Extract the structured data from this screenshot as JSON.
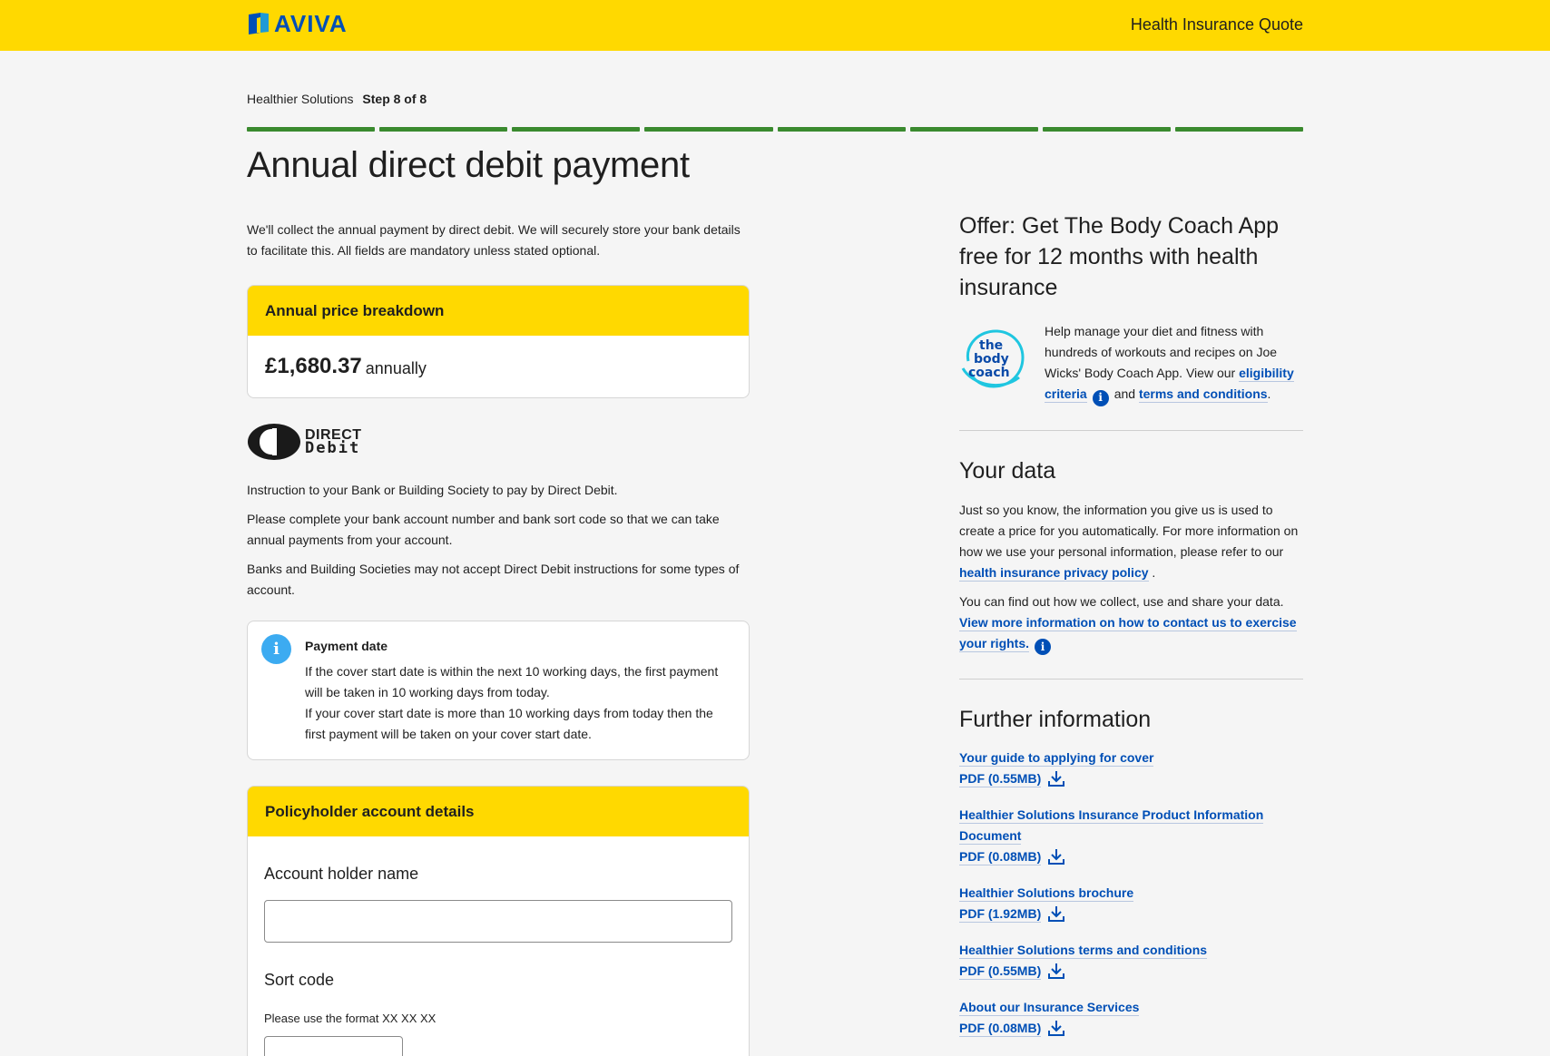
{
  "header": {
    "brand": "AVIVA",
    "title": "Health Insurance Quote"
  },
  "progress": {
    "label": "Healthier Solutions",
    "step": "Step 8 of 8",
    "current": 8,
    "total": 8
  },
  "page": {
    "title": "Annual direct debit payment",
    "intro": "We'll collect the annual payment by direct debit. We will securely store your bank details to facilitate this. All fields are mandatory unless stated optional."
  },
  "price": {
    "heading": "Annual price breakdown",
    "amount": "£1,680.37",
    "unit": "annually"
  },
  "direct_debit": {
    "logo_line1": "DIRECT",
    "logo_line2": "Debit",
    "p1": "Instruction to your Bank or Building Society to pay by Direct Debit.",
    "p2": "Please complete your bank account number and bank sort code so that we can take annual payments from your account.",
    "p3": "Banks and Building Societies may not accept Direct Debit instructions for some types of account."
  },
  "payment_date": {
    "icon": "info-icon",
    "title": "Payment date",
    "line1": "If the cover start date is within the next 10 working days, the first payment will be taken in 10 working days from today.",
    "line2": "If your cover start date is more than 10 working days from today then the first payment will be taken on your cover start date."
  },
  "account": {
    "heading": "Policyholder account details",
    "name_label": "Account holder name",
    "name_value": "",
    "sort_label": "Sort code",
    "sort_hint": "Please use the format XX XX XX",
    "sort_value": ""
  },
  "offer": {
    "title": "Offer: Get The Body Coach App free for 12 months with health insurance",
    "logo_text": [
      "the",
      "body",
      "coach"
    ],
    "text_before": "Help manage your diet and fitness with hundreds of workouts and recipes on Joe Wicks' Body Coach App. View our ",
    "eligibility_link": "eligibility criteria",
    "and_text": "and",
    "terms_link": "terms and conditions",
    "end": "."
  },
  "your_data": {
    "title": "Your data",
    "p1_text": "Just so you know, the information you give us is used to create a price for you automatically.  For more information on how we use your personal information, please refer to our ",
    "p1_link": "health insurance privacy policy",
    "p1_end": " .",
    "p2_text": "You can find out how we collect, use and share your data.",
    "p2_link": "View more information on how to contact us to exercise your rights."
  },
  "further": {
    "title": "Further information",
    "docs": [
      {
        "title": "Your guide to applying for cover",
        "file": "PDF (0.55MB)"
      },
      {
        "title": "Healthier Solutions Insurance Product Information Document",
        "file": "PDF (0.08MB)"
      },
      {
        "title": "Healthier Solutions brochure",
        "file": "PDF (1.92MB)"
      },
      {
        "title": "Healthier Solutions terms and conditions",
        "file": "PDF (0.55MB)"
      },
      {
        "title": "About our Insurance Services",
        "file": "PDF (0.08MB)"
      }
    ]
  },
  "colors": {
    "brand_yellow": "#ffd900",
    "brand_blue": "#004fb6",
    "progress_green": "#3a8a2e",
    "info_blue": "#3cabf1"
  }
}
